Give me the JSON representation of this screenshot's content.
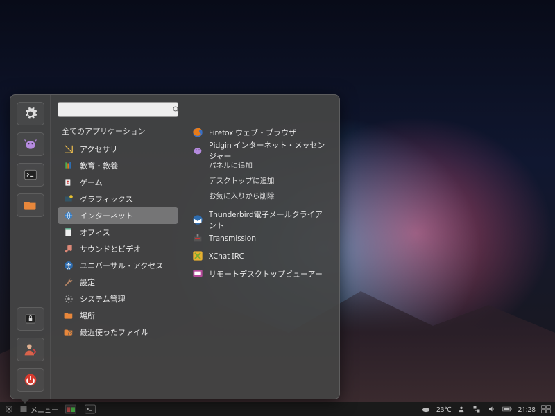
{
  "taskbar": {
    "menu_label": "メニュー",
    "weather": "23℃",
    "time": "21:28"
  },
  "menu": {
    "search": {
      "placeholder": ""
    },
    "categories_header": "全てのアプリケーション",
    "categories": [
      {
        "id": "accessories",
        "label": "アクセサリ"
      },
      {
        "id": "education",
        "label": "教育・教養"
      },
      {
        "id": "games",
        "label": "ゲーム"
      },
      {
        "id": "graphics",
        "label": "グラフィックス"
      },
      {
        "id": "internet",
        "label": "インターネット",
        "selected": true
      },
      {
        "id": "office",
        "label": "オフィス"
      },
      {
        "id": "sound",
        "label": "サウンドとビデオ"
      },
      {
        "id": "universal",
        "label": "ユニバーサル・アクセス"
      },
      {
        "id": "settings",
        "label": "設定"
      },
      {
        "id": "system",
        "label": "システム管理"
      },
      {
        "id": "places",
        "label": "場所"
      },
      {
        "id": "recent",
        "label": "最近使ったファイル"
      }
    ],
    "apps": {
      "firefox": "Firefox ウェブ・ブラウザ",
      "pidgin": "Pidgin インターネット・メッセンジャー",
      "ctx_panel": "パネルに追加",
      "ctx_desktop": "デスクトップに追加",
      "ctx_unfav": "お気に入りから削除",
      "thunderbird": "Thunderbird電子メールクライアント",
      "transmission": "Transmission",
      "xchat": "XChat IRC",
      "remote": "リモートデスクトップビューアー"
    }
  }
}
